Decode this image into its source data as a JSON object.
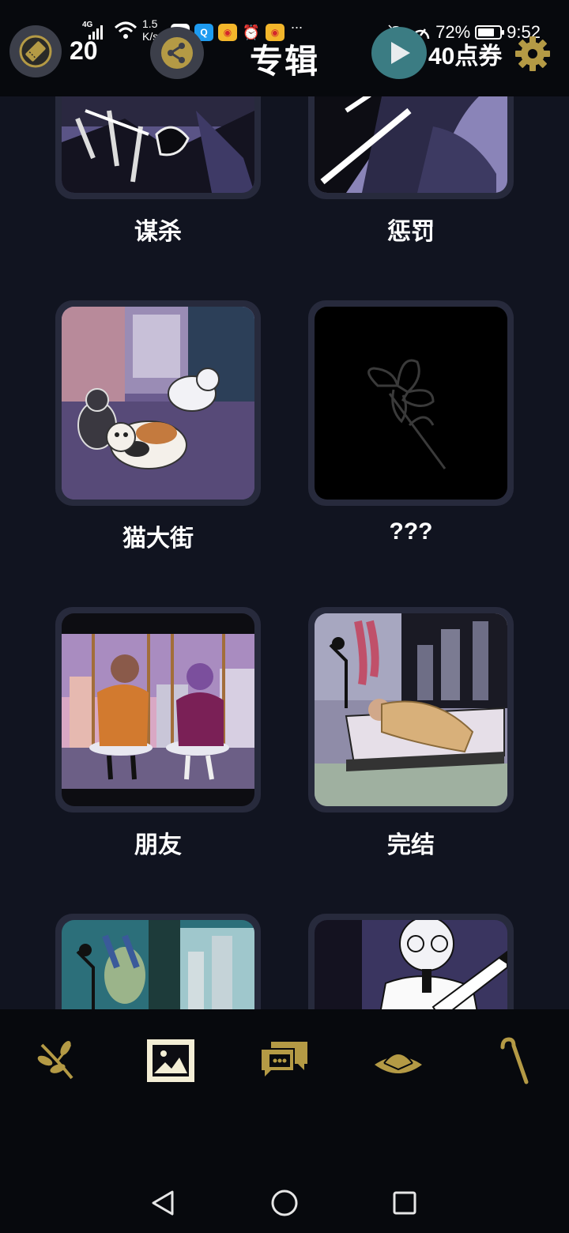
{
  "status_bar": {
    "network": "4G",
    "speed_value": "1.5",
    "speed_unit": "K/s",
    "more": "...",
    "battery": "72%",
    "time": "9:52"
  },
  "header": {
    "ticket_count": "20",
    "title": "专辑",
    "points": "40点券"
  },
  "albums": [
    {
      "label": "谋杀"
    },
    {
      "label": "惩罚"
    },
    {
      "label": "猫大街"
    },
    {
      "label": "???"
    },
    {
      "label": "朋友"
    },
    {
      "label": "完结"
    },
    {
      "label": ""
    },
    {
      "label": ""
    }
  ],
  "bottom_nav": {
    "items": [
      {
        "icon": "branch-icon"
      },
      {
        "icon": "gallery-icon",
        "active": true
      },
      {
        "icon": "messages-icon"
      },
      {
        "icon": "hat-icon"
      },
      {
        "icon": "cane-icon"
      }
    ]
  },
  "colors": {
    "background": "#111420",
    "bar": "#07090d",
    "accent_gold": "#b49a45",
    "card_frame": "#272a3c",
    "play_button": "#3b7c83"
  }
}
